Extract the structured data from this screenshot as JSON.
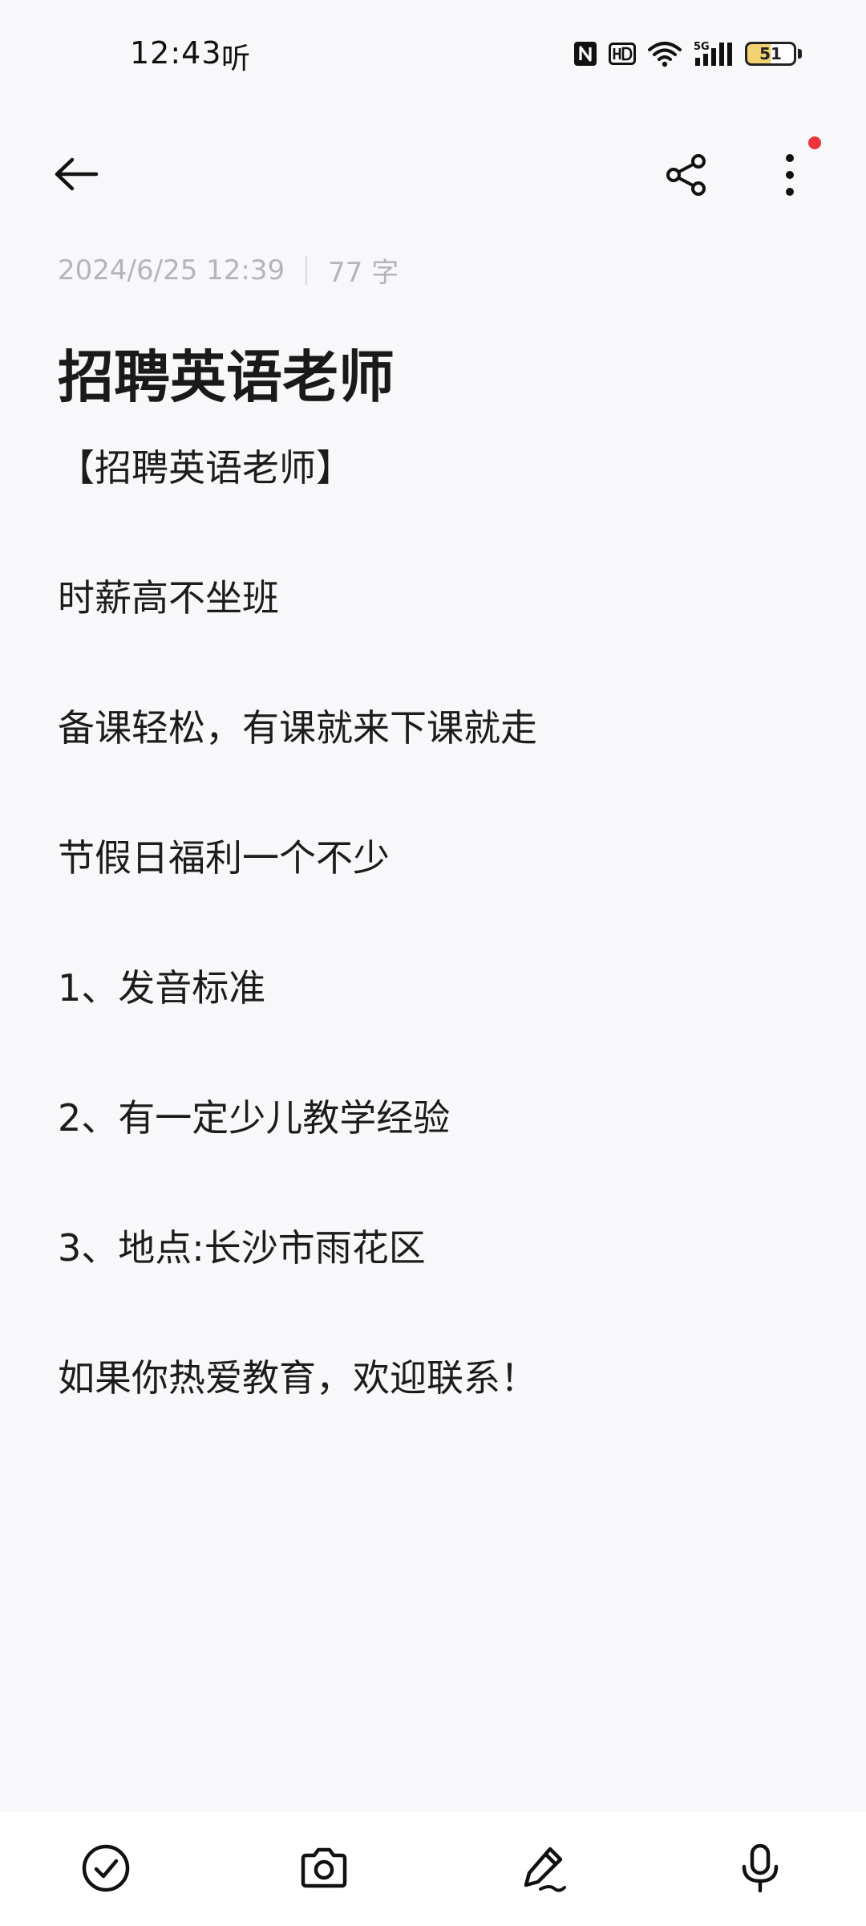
{
  "status_bar": {
    "time": "12:43",
    "listen_indicator": "听",
    "icons": [
      "nfc-icon",
      "hd-icon",
      "wifi-icon",
      "5g-signal-icon",
      "battery-icon"
    ],
    "battery_level": "51"
  },
  "toolbar": {
    "back_icon": "arrow-left-icon",
    "share_icon": "share-icon",
    "more_icon": "more-vertical-icon",
    "notification_dot_color": "#e8343a"
  },
  "note": {
    "date": "2024/6/25 12:39",
    "word_count": "77 字",
    "title": "招聘英语老师",
    "lines": [
      "【招聘英语老师】",
      "时薪高不坐班",
      "备课轻松，有课就来下课就走",
      "节假日福利一个不少",
      "1、发音标准",
      "2、有一定少儿教学经验",
      "3、地点:长沙市雨花区",
      "如果你热爱教育，欢迎联系！"
    ]
  },
  "bottom_toolbar": {
    "items": [
      "checklist-icon",
      "camera-icon",
      "pen-icon",
      "microphone-icon"
    ]
  }
}
